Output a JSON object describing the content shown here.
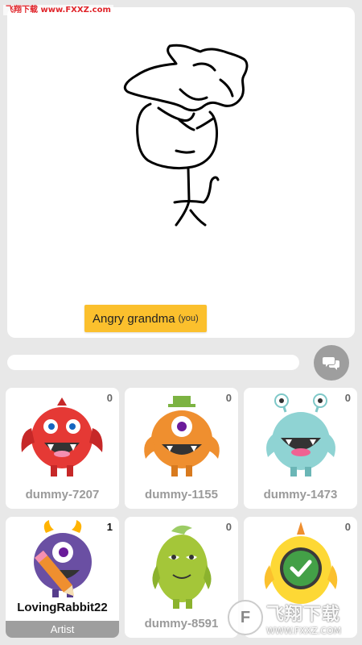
{
  "watermark": {
    "top": "飞翔下载 www.FXXZ.com",
    "bottom_title": "飞翔下载",
    "bottom_url": "WWW.FXXZ.COM"
  },
  "canvas": {
    "word": "Angry grandma",
    "you_tag": "(you)"
  },
  "colors": {
    "tag": "#fbc02d",
    "chat_button": "#9e9e9e",
    "background": "#e8e8e8"
  },
  "icons": {
    "chat": "chat-bubbles-icon",
    "check": "check-icon"
  },
  "players": [
    {
      "name": "dummy-7207",
      "score": "0"
    },
    {
      "name": "dummy-1155",
      "score": "0"
    },
    {
      "name": "dummy-1473",
      "score": "0"
    },
    {
      "name": "LovingRabbit22",
      "score": "1",
      "role": "Artist"
    },
    {
      "name": "dummy-8591",
      "score": "0"
    },
    {
      "name": "",
      "score": "0"
    }
  ]
}
